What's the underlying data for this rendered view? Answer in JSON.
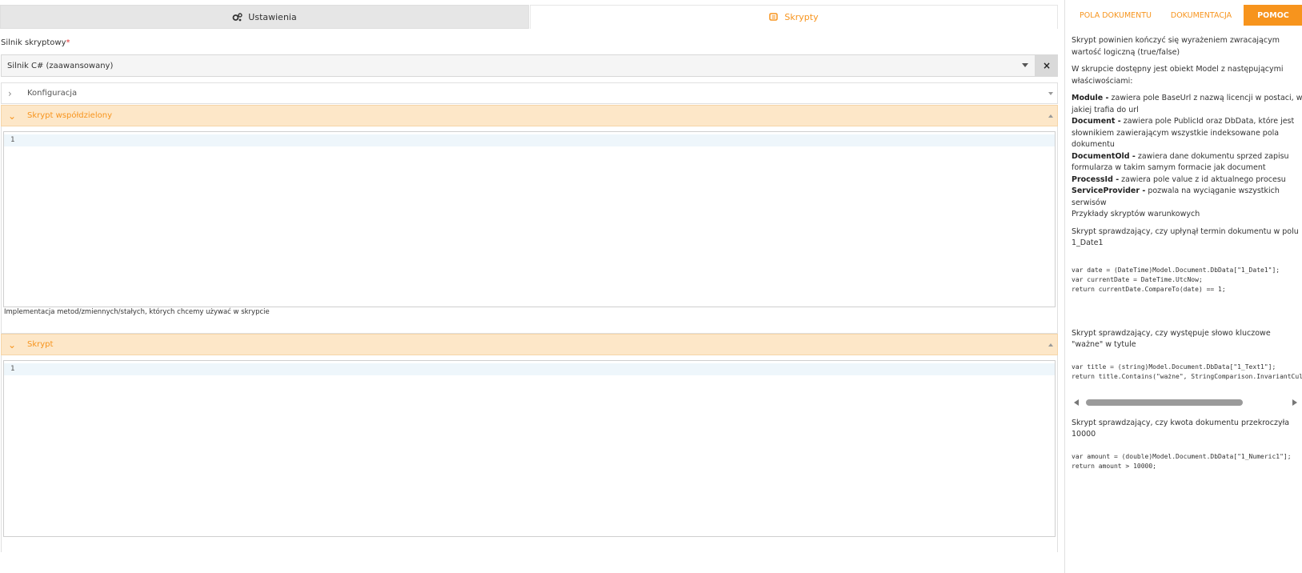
{
  "tabs": {
    "settings": "Ustawienia",
    "scripts": "Skrypty"
  },
  "engine": {
    "label": "Silnik skryptowy",
    "required_mark": "*",
    "value": "Silnik C# (zaawansowany)",
    "clear": "×"
  },
  "sections": {
    "config": "Konfiguracja",
    "shared": "Skrypt współdzielony",
    "shared_hint": "Implementacja metod/zmiennych/stałych, których chcemy używać w skrypcie",
    "script": "Skrypt"
  },
  "editor": {
    "line_number": "1"
  },
  "right_tabs": {
    "fields": "POLA DOKUMENTU",
    "docs": "DOKUMENTACJA",
    "help": "POMOC"
  },
  "help": {
    "p1": "Skrypt powinien kończyć się wyrażeniem zwracającym wartość logiczną (true/false)",
    "p2": "W skrupcie dostępny jest obiekt Model z następującymi właściwościami:",
    "props": [
      {
        "name": "Module -",
        "desc": " zawiera pole BaseUrl z nazwą licencji w postaci, w jakiej trafia do url"
      },
      {
        "name": "Document -",
        "desc": " zawiera pole PublicId oraz DbData, które jest słownikiem zawierającym wszystkie indeksowane pola dokumentu"
      },
      {
        "name": "DocumentOld -",
        "desc": " zawiera dane dokumentu sprzed zapisu formularza w takim samym formacie jak document"
      },
      {
        "name": "ProcessId -",
        "desc": " zawiera pole value z id aktualnego procesu"
      },
      {
        "name": "ServiceProvider -",
        "desc": " pozwala na wyciąganie wszystkich serwisów"
      }
    ],
    "examples_title": "Przykłady skryptów warunkowych",
    "ex1_title": "Skrypt sprawdzający, czy upłynął termin dokumentu w polu 1_Date1",
    "ex1_code": "var date = (DateTime)Model.Document.DbData[\"1_Date1\"];\nvar currentDate = DateTime.UtcNow;\nreturn currentDate.CompareTo(date) == 1;",
    "ex2_title": "Skrypt sprawdzający, czy występuje słowo kluczowe \"ważne\" w tytule",
    "ex2_code": "var title = (string)Model.Document.DbData[\"1_Text1\"];\nreturn title.Contains(\"ważne\", StringComparison.InvariantCul",
    "ex3_title": "Skrypt sprawdzający, czy kwota dokumentu przekroczyła 10000",
    "ex3_code": "var amount = (double)Model.Document.DbData[\"1_Numeric1\"];\nreturn amount > 10000;"
  },
  "colors": {
    "accent": "#f7941d",
    "section_bg": "#fde7c8"
  }
}
